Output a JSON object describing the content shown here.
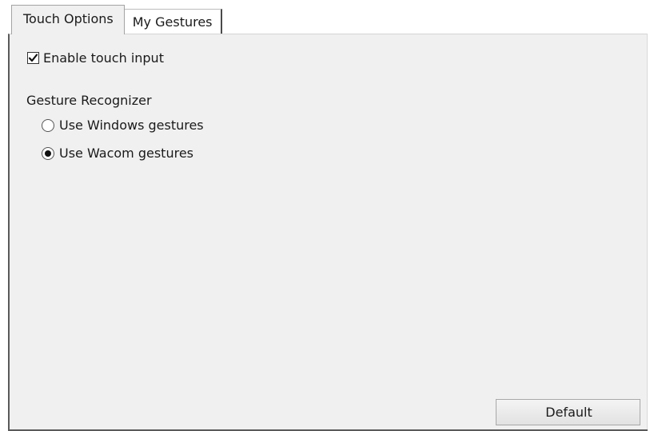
{
  "tabs": [
    {
      "label": "Touch Options",
      "active": true
    },
    {
      "label": "My Gestures",
      "active": false
    }
  ],
  "touch_options": {
    "enable_touch": {
      "label": "Enable touch input",
      "checked": true
    },
    "gesture_recognizer": {
      "label": "Gesture Recognizer",
      "options": [
        {
          "label": "Use Windows gestures",
          "selected": false
        },
        {
          "label": "Use Wacom gestures",
          "selected": true
        }
      ]
    }
  },
  "buttons": {
    "default_label": "Default"
  }
}
